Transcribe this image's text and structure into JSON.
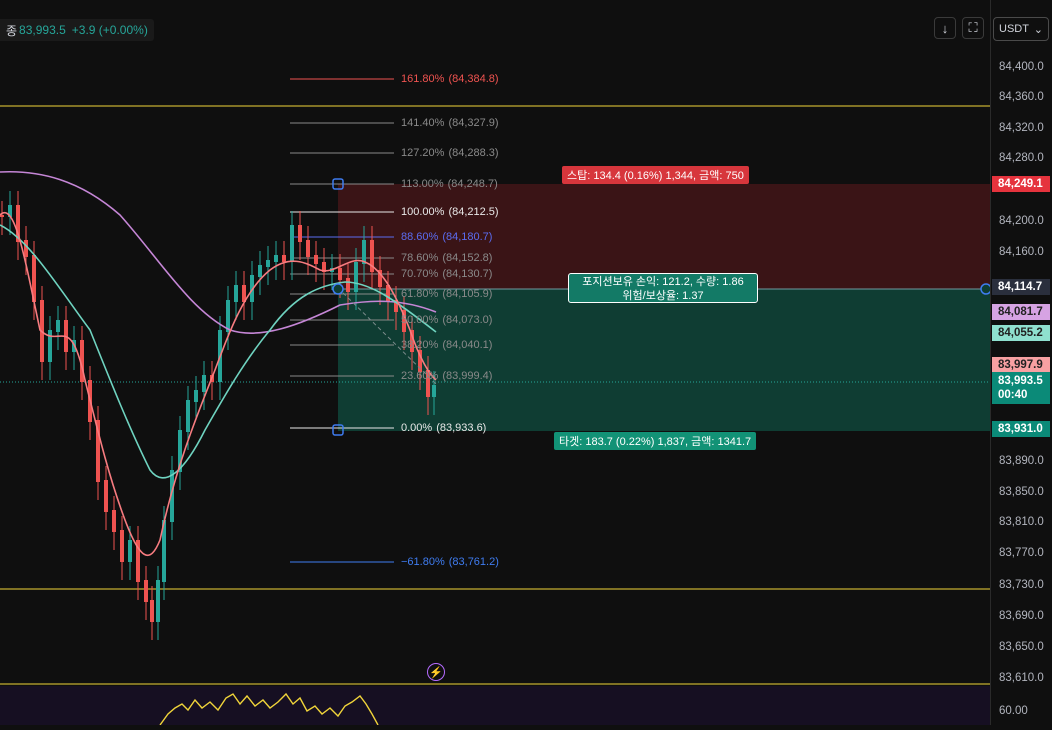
{
  "header": {
    "close_label": "종",
    "last_price": "83,993.5",
    "change": "+3.9 (+0.00%)",
    "currency_select": "USDT",
    "currency_caret": "⌄",
    "download_icon": "↓",
    "fullscreen_icon": "⛶"
  },
  "price_axis": {
    "ticks": [
      "84,400.0",
      "84,360.0",
      "84,320.0",
      "84,280.0",
      "84,200.0",
      "84,160.0",
      "83,890.0",
      "83,850.0",
      "83,810.0",
      "83,770.0",
      "83,730.0",
      "83,690.0",
      "83,650.0",
      "83,610.0"
    ],
    "labels": {
      "stop": "84,249.1",
      "entry": "84,114.7",
      "ma_purple": "84,081.7",
      "ma_teal": "84,055.2",
      "ma_red": "83,997.9",
      "last": "83,993.5",
      "countdown": "00:40",
      "target": "83,931.0"
    },
    "bottom_tick": "60.00"
  },
  "fib_levels": [
    {
      "pct": "161.80%",
      "price": "(84,384.8)",
      "color": "#ef5350"
    },
    {
      "pct": "141.40%",
      "price": "(84,327.9)",
      "color": "#8a8a8a"
    },
    {
      "pct": "127.20%",
      "price": "(84,288.3)",
      "color": "#8a8a8a"
    },
    {
      "pct": "113.00%",
      "price": "(84,248.7)",
      "color": "#8a8a8a"
    },
    {
      "pct": "100.00%",
      "price": "(84,212.5)",
      "color": "#e8e8e8"
    },
    {
      "pct": "88.60%",
      "price": "(84,180.7)",
      "color": "#5b6cf0"
    },
    {
      "pct": "78.60%",
      "price": "(84,152.8)",
      "color": "#8a8a8a"
    },
    {
      "pct": "70.70%",
      "price": "(84,130.7)",
      "color": "#8a8a8a"
    },
    {
      "pct": "61.80%",
      "price": "(84,105.9)",
      "color": "#8a8a8a"
    },
    {
      "pct": "50.00%",
      "price": "(84,073.0)",
      "color": "#8a8a8a"
    },
    {
      "pct": "38.20%",
      "price": "(84,040.1)",
      "color": "#8a8a8a"
    },
    {
      "pct": "23.60%",
      "price": "(83,999.4)",
      "color": "#8a8a8a"
    },
    {
      "pct": "0.00%",
      "price": "(83,933.6)",
      "color": "#e8e8e8"
    },
    {
      "pct": "−61.80%",
      "price": "(83,761.2)",
      "color": "#3f7cf0"
    }
  ],
  "position": {
    "stop_label": "스탑: 134.4 (0.16%) 1,344, 금액: 750",
    "pnl_line1": "포지션보유 손익: 121.2, 수량: 1.86",
    "pnl_line2": "위험/보상율: 1.37",
    "target_label": "타겟: 183.7 (0.22%) 1,837, 금액: 1341.7"
  },
  "colors": {
    "up": "#26a69a",
    "down": "#ef5350",
    "stop_zone": "#3a1416",
    "target_zone": "#0f3d33",
    "ma_red": "#f77c80",
    "ma_teal": "#6fd3c0",
    "ma_purple": "#c586d6",
    "level_line": "#f0d43a"
  },
  "icons": {
    "bolt": "⚡"
  }
}
